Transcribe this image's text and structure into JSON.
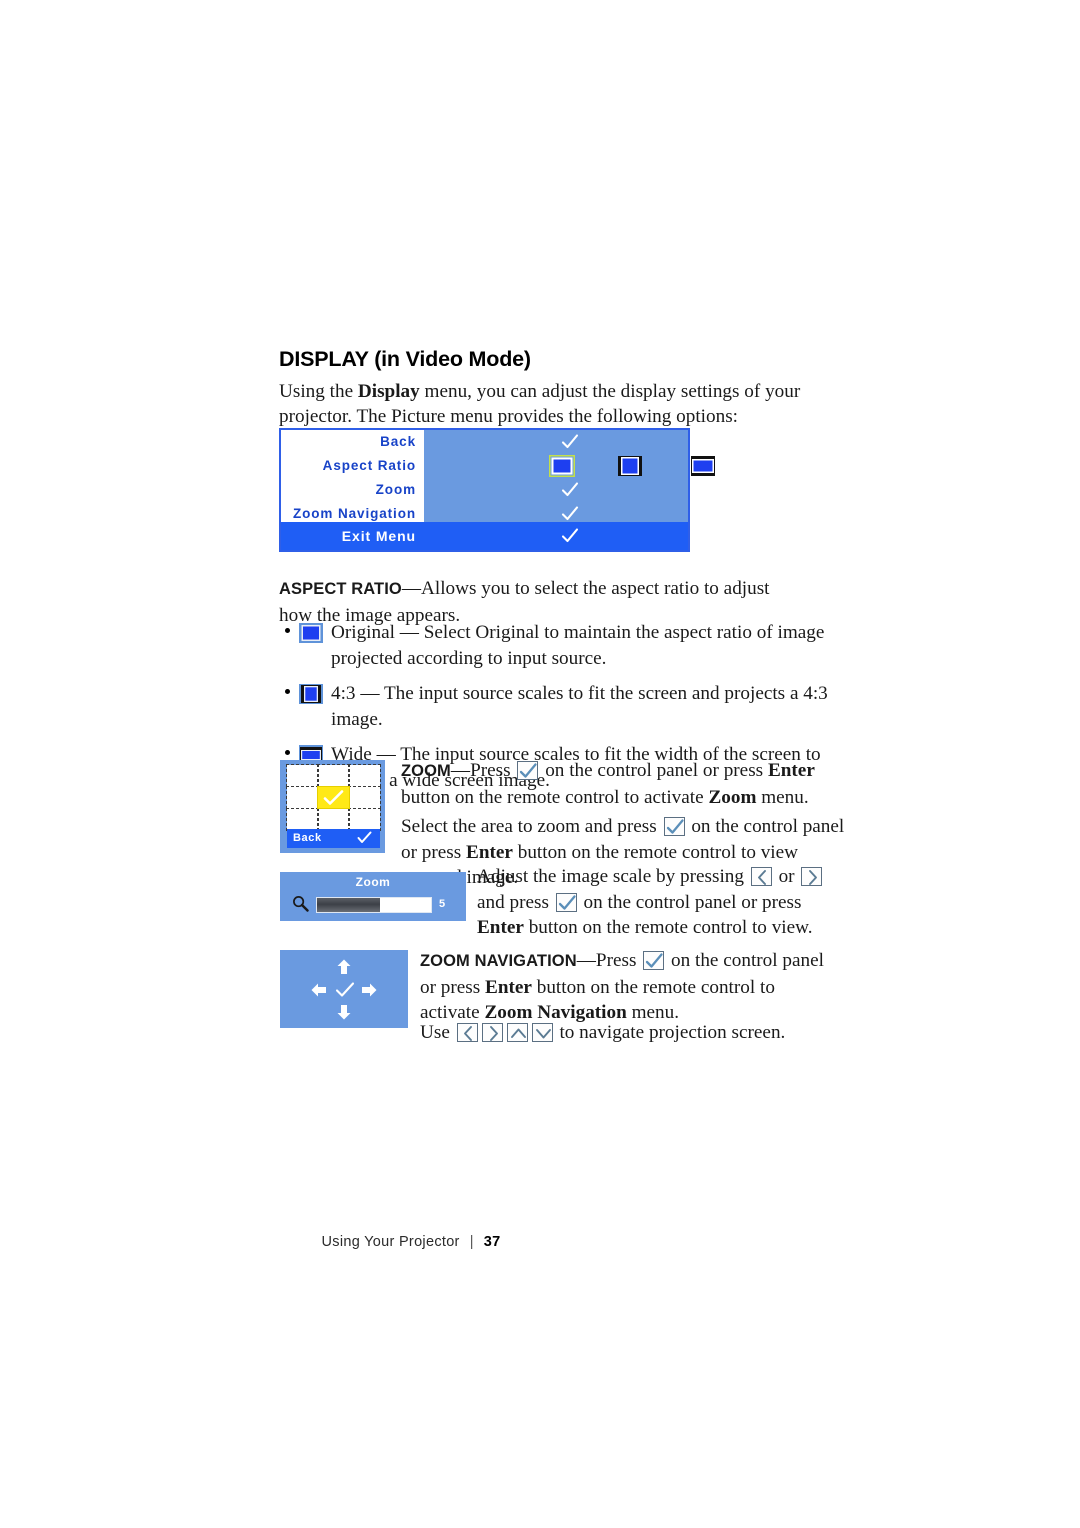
{
  "page": {
    "heading": "DISPLAY (in Video Mode)",
    "intro_before": "Using the ",
    "intro_bold": "Display",
    "intro_after": " menu, you can adjust the display settings of your projector. The Picture menu provides the following options:"
  },
  "osd_menu": {
    "rows": [
      {
        "label": "Back",
        "value_icon": "checkmark-icon"
      },
      {
        "label": "Aspect Ratio",
        "value_icon": "aspect-ratio-icons"
      },
      {
        "label": "Zoom",
        "value_icon": "checkmark-icon"
      },
      {
        "label": "Zoom Navigation",
        "value_icon": "checkmark-icon"
      }
    ],
    "exit_label": "Exit Menu",
    "exit_icon": "checkmark-icon",
    "aspect_icons": [
      {
        "name": "aspect-original-icon",
        "selected": true
      },
      {
        "name": "aspect-4-3-icon",
        "selected": false
      },
      {
        "name": "aspect-wide-icon",
        "selected": false
      }
    ],
    "colors": {
      "panel_bg": "#6a9ae0",
      "panel_border": "#2f5fe8",
      "label_bg": "#ffffff",
      "label_text": "#1843c8",
      "exit_bg": "#1f5ef5",
      "exit_text": "#ffffff",
      "selection_highlight": "#c3e04a"
    }
  },
  "aspect_ratio_section": {
    "term": "ASPECT RATIO",
    "term_caps": "A",
    "description": "—Allows you to select the aspect ratio to adjust how the image appears.",
    "bullets": [
      {
        "icon": "aspect-original-icon",
        "text": "Original — Select Original to maintain the aspect ratio of image projected according to input source."
      },
      {
        "icon": "aspect-4-3-icon",
        "text": "4:3 — The input source scales to fit the screen and projects a 4:3 image."
      },
      {
        "icon": "aspect-wide-icon",
        "text": "Wide — The input source scales to fit the width of the screen to project a wide screen image."
      }
    ]
  },
  "zoom_section": {
    "term": "ZOOM",
    "p1_a": "—Press ",
    "p1_key": "enter-check-key",
    "p1_b": " on the control panel or press ",
    "p1_bold": "Enter",
    "p1_c": " button on the remote control to activate ",
    "p1_bold2": "Zoom",
    "p1_d": " menu.",
    "p2_a": "Select the area to zoom and press ",
    "p2_key": "enter-check-key",
    "p2_b": " on the control panel or press ",
    "p2_bold": "Enter",
    "p2_c": " button on the remote control to view zoomed image.",
    "grid": {
      "back_label": "Back",
      "back_icon": "checkmark-icon",
      "selected_cell": 4,
      "cells": 9,
      "selected_color": "#ffe916"
    },
    "slider": {
      "title": "Zoom",
      "value": "5",
      "fill_percent": 55,
      "magnifier_icon": "magnifier-icon"
    },
    "p3_a": "Adjust the image scale by pressing ",
    "p3_key_left": "left-arrow-key",
    "p3_or": " or ",
    "p3_key_right": "right-arrow-key",
    "p3_b": " and press ",
    "p3_key_enter": "enter-check-key",
    "p3_c": " on the control panel or press ",
    "p3_bold": "Enter",
    "p3_d": " button on the remote control to view."
  },
  "zoom_navigation_section": {
    "term": "ZOOM NAVIGATION",
    "p1_a": "—Press ",
    "p1_key": "enter-check-key",
    "p1_b": " on the control panel or press ",
    "p1_bold": "Enter",
    "p1_c": " button on the remote control to activate ",
    "p1_bold2": "Zoom Navigation",
    "p1_d": " menu.",
    "p2_a": "Use ",
    "p2_keys": [
      "left-arrow-key",
      "right-arrow-key",
      "up-arrow-key",
      "down-arrow-key"
    ],
    "p2_b": " to navigate projection screen.",
    "graphic": {
      "icons": [
        "up-arrow-icon",
        "left-arrow-icon",
        "checkmark-icon",
        "right-arrow-icon",
        "down-arrow-icon"
      ],
      "bg_color": "#6a9ae0"
    }
  },
  "footer": {
    "section": "Using Your Projector",
    "separator": "|",
    "page_number": "37"
  }
}
